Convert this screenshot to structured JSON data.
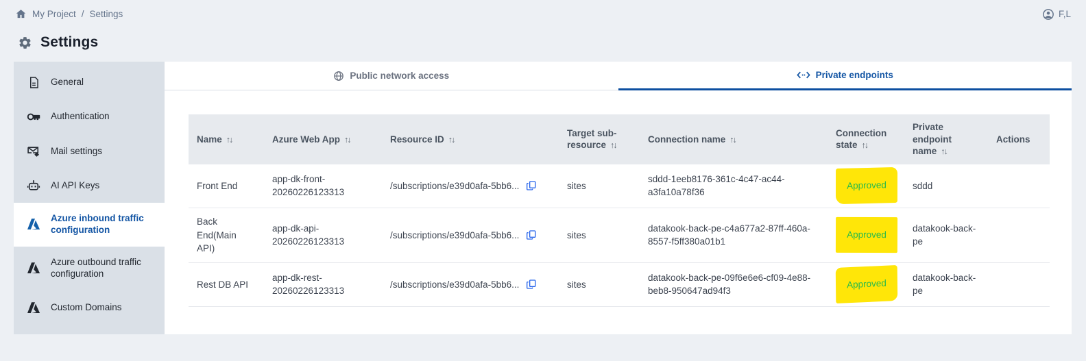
{
  "breadcrumb": {
    "project": "My Project",
    "separator": "/",
    "current": "Settings"
  },
  "user": {
    "display_name": "F,L"
  },
  "page": {
    "title": "Settings"
  },
  "sidebar": {
    "items": [
      {
        "label": "General",
        "icon": "document-icon",
        "active": false
      },
      {
        "label": "Authentication",
        "icon": "key-icon",
        "active": false
      },
      {
        "label": "Mail settings",
        "icon": "mail-gear-icon",
        "active": false
      },
      {
        "label": "AI API Keys",
        "icon": "robot-icon",
        "active": false
      },
      {
        "label": "Azure inbound traffic configuration",
        "icon": "azure-icon",
        "active": true
      },
      {
        "label": "Azure outbound traffic configuration",
        "icon": "azure-icon",
        "active": false
      },
      {
        "label": "Custom Domains",
        "icon": "azure-icon",
        "active": false
      }
    ]
  },
  "tabs": [
    {
      "label": "Public network access",
      "icon": "globe-icon",
      "active": false
    },
    {
      "label": "Private endpoints",
      "icon": "endpoint-arrows-icon",
      "active": true
    }
  ],
  "icons": {
    "sort_glyph": "↑↓"
  },
  "table": {
    "columns": [
      "Name",
      "Azure Web App",
      "Resource ID",
      "Target sub-resource",
      "Connection name",
      "Connection state",
      "Private endpoint name",
      "Actions"
    ],
    "rows": [
      {
        "name": "Front End",
        "azure_web_app": "app-dk-front-20260226123313",
        "resource_id": "/subscriptions/e39d0afa-5bb6...",
        "target_sub_resource": "sites",
        "connection_name": "sddd-1eeb8176-361c-4c47-ac44-a3fa10a78f36",
        "connection_state": "Approved",
        "private_endpoint_name": "sddd"
      },
      {
        "name": "Back End(Main API)",
        "azure_web_app": "app-dk-api-20260226123313",
        "resource_id": "/subscriptions/e39d0afa-5bb6...",
        "target_sub_resource": "sites",
        "connection_name": "datakook-back-pe-c4a677a2-87ff-460a-8557-f5ff380a01b1",
        "connection_state": "Approved",
        "private_endpoint_name": "datakook-back-pe"
      },
      {
        "name": "Rest DB API",
        "azure_web_app": "app-dk-rest-20260226123313",
        "resource_id": "/subscriptions/e39d0afa-5bb6...",
        "target_sub_resource": "sites",
        "connection_name": "datakook-back-pe-09f6e6e6-cf09-4e88-beb8-950647ad94f3",
        "connection_state": "Approved",
        "private_endpoint_name": "datakook-back-pe"
      }
    ]
  },
  "colors": {
    "accent_blue": "#1355a4",
    "tab_underline": "#0d4fa0",
    "approved_green": "#27ba4b",
    "highlight_yellow": "#ffe608",
    "copy_icon_blue": "#2563eb",
    "sidebar_bg": "#dae0e7",
    "table_header_bg": "#e7eaee",
    "page_bg": "#edf0f4"
  }
}
